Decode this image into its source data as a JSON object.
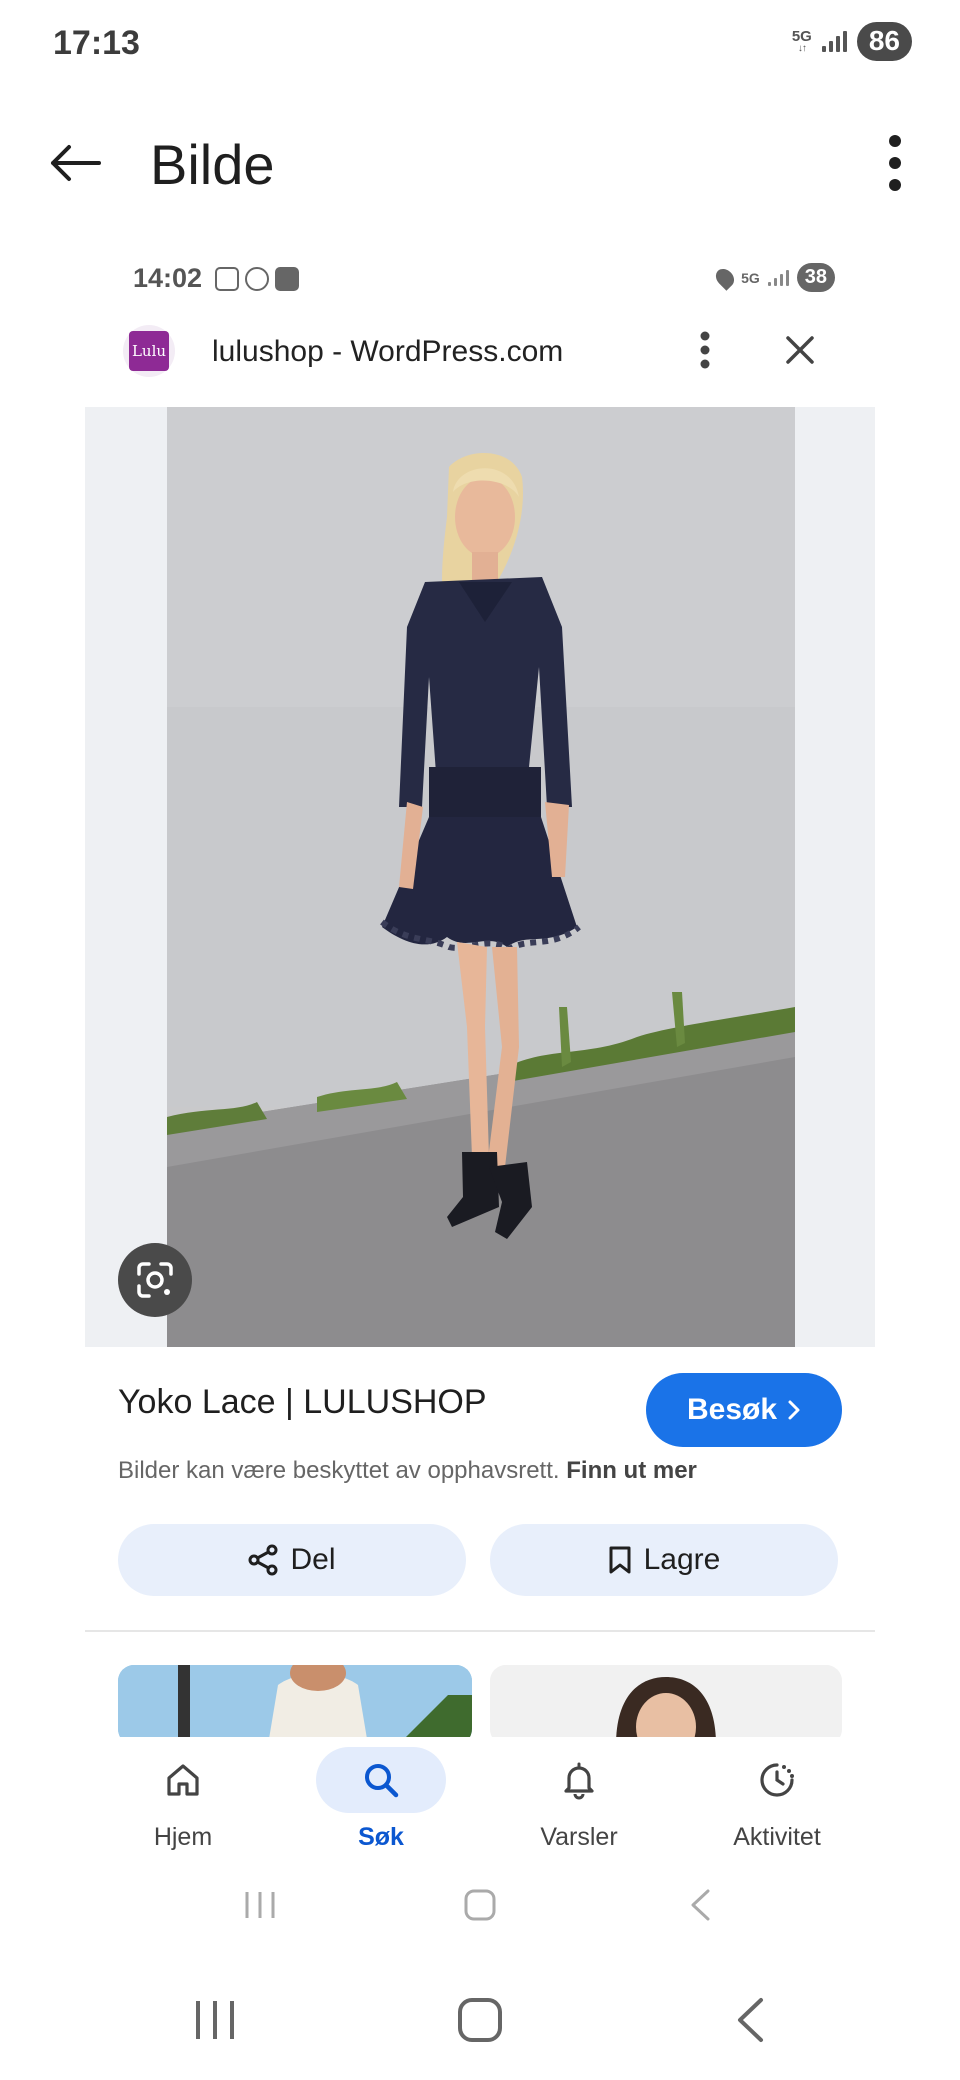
{
  "status_bar": {
    "time": "17:13",
    "network": "5G",
    "battery": "86"
  },
  "app_bar": {
    "title": "Bilde"
  },
  "inner_screenshot": {
    "status_time": "14:02",
    "status_network": "5G",
    "status_battery": "38",
    "site_name": "lulushop - WordPress.com",
    "favicon_text": "Lulu"
  },
  "result": {
    "title": "Yoko Lace | LULUSHOP",
    "visit_label": "Besøk",
    "copyright_text": "Bilder kan være beskyttet av opphavsrett.",
    "learn_more": "Finn ut mer",
    "share_label": "Del",
    "save_label": "Lagre"
  },
  "bottom_nav": {
    "items": [
      {
        "label": "Hjem",
        "icon": "home-icon"
      },
      {
        "label": "Søk",
        "icon": "search-icon",
        "active": true
      },
      {
        "label": "Varsler",
        "icon": "bell-icon"
      },
      {
        "label": "Aktivitet",
        "icon": "activity-icon"
      }
    ]
  },
  "colors": {
    "accent": "#1a73e8",
    "active_nav": "#0b57d0",
    "button_bg": "#e8effb"
  }
}
